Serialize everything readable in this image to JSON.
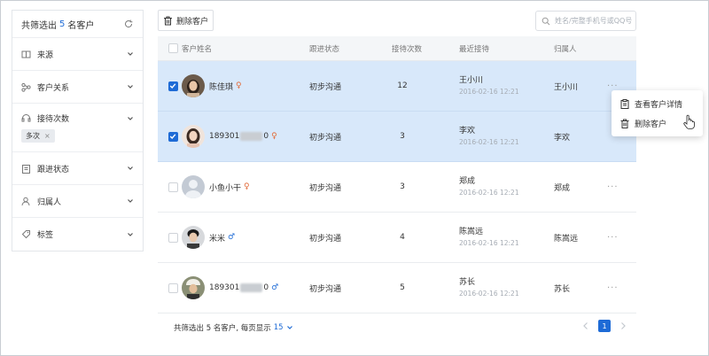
{
  "filter": {
    "title_prefix": "共筛选出",
    "count": "5",
    "title_suffix": "名客户",
    "items": [
      {
        "label": "来源",
        "icon": "book-icon"
      },
      {
        "label": "客户关系",
        "icon": "relation-icon"
      },
      {
        "label": "接待次数",
        "icon": "headset-icon",
        "tag": "多次"
      },
      {
        "label": "跟进状态",
        "icon": "clipboard-icon"
      },
      {
        "label": "归属人",
        "icon": "user-icon"
      },
      {
        "label": "标签",
        "icon": "tag-icon"
      }
    ]
  },
  "toolbar": {
    "delete_label": "删除客户"
  },
  "search": {
    "placeholder": "姓名/完整手机号或QQ号"
  },
  "table": {
    "headers": [
      "客户姓名",
      "跟进状态",
      "接待次数",
      "最近接待",
      "归属人"
    ],
    "rows": [
      {
        "name": "陈佳琪",
        "gender": "♀",
        "status": "初步沟通",
        "times": "12",
        "recent_name": "王小川",
        "recent_time": "2016-02-16  12:21",
        "owner": "王小川",
        "selected": true
      },
      {
        "name_prefix": "189301",
        "name_suffix": "0",
        "gender": "♀",
        "status": "初步沟通",
        "times": "3",
        "recent_name": "李欢",
        "recent_time": "2016-02-16  12:21",
        "owner": "李欢",
        "selected": true
      },
      {
        "name": "小鱼小干",
        "gender": "♀",
        "status": "初步沟通",
        "times": "3",
        "recent_name": "郑成",
        "recent_time": "2016-02-16  12:21",
        "owner": "郑成",
        "selected": false
      },
      {
        "name": "米米",
        "gender": "♂",
        "status": "初步沟通",
        "times": "4",
        "recent_name": "陈嵩远",
        "recent_time": "2016-02-16  12:21",
        "owner": "陈嵩远",
        "selected": false
      },
      {
        "name_prefix": "189301",
        "name_suffix": "0",
        "gender": "♂",
        "status": "初步沟通",
        "times": "5",
        "recent_name": "苏长",
        "recent_time": "2016-02-16  12:21",
        "owner": "苏长",
        "selected": false
      }
    ],
    "more": "···"
  },
  "footer": {
    "text": "共筛选出 5 名客户, 每页显示",
    "page_size": "15"
  },
  "pager": {
    "current": "1"
  },
  "menu": {
    "view_label": "查看客户详情",
    "delete_label": "删除客户"
  },
  "colors": {
    "accent": "#1e6bd6",
    "selected_row": "#d8e8fa",
    "female": "#e26b3a"
  }
}
